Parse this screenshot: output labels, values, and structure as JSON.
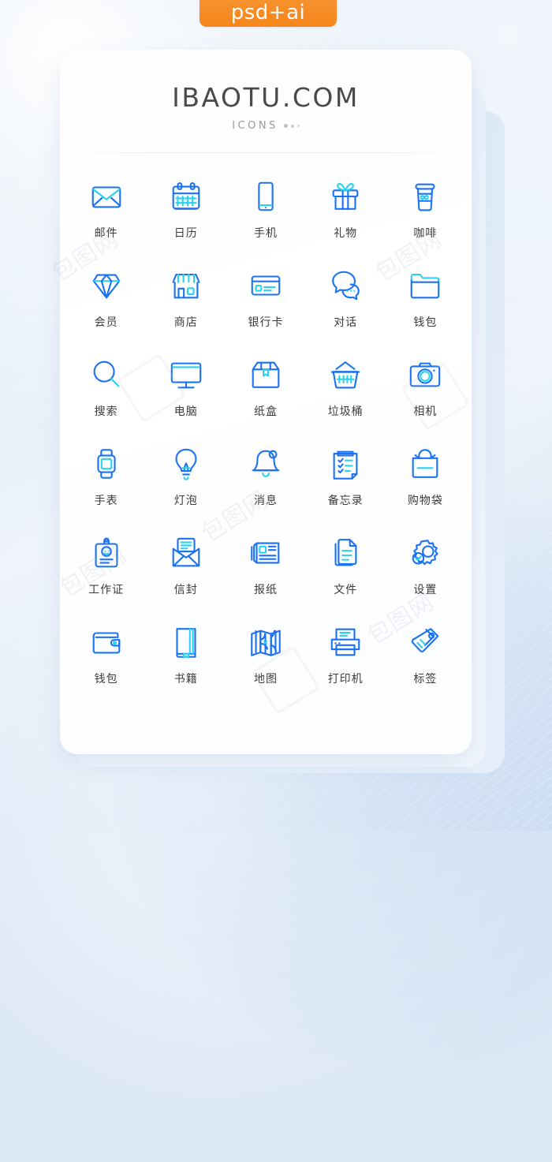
{
  "badge": {
    "label": "psd+ai",
    "color": "#F5861B"
  },
  "header": {
    "title": "IBAOTU.COM",
    "subtitle": "ICONS"
  },
  "theme": {
    "icon_blue": "#1B72F2",
    "icon_cyan": "#29D2F0",
    "label_color": "#3B3B3B",
    "background": "#DCE8F6",
    "card_background": "#FFFFFF"
  },
  "watermarks": [
    "包图网",
    "包图网",
    "包图网",
    "包图网",
    "包图网"
  ],
  "icons": [
    {
      "label": "邮件",
      "name": "mail-icon"
    },
    {
      "label": "日历",
      "name": "calendar-icon"
    },
    {
      "label": "手机",
      "name": "phone-icon"
    },
    {
      "label": "礼物",
      "name": "gift-icon"
    },
    {
      "label": "咖啡",
      "name": "coffee-icon"
    },
    {
      "label": "会员",
      "name": "diamond-member-icon"
    },
    {
      "label": "商店",
      "name": "store-icon"
    },
    {
      "label": "银行卡",
      "name": "bank-card-icon"
    },
    {
      "label": "对话",
      "name": "chat-bubbles-icon"
    },
    {
      "label": "钱包",
      "name": "folder-icon"
    },
    {
      "label": "搜索",
      "name": "search-icon"
    },
    {
      "label": "电脑",
      "name": "computer-monitor-icon"
    },
    {
      "label": "纸盒",
      "name": "paper-box-icon"
    },
    {
      "label": "垃圾桶",
      "name": "trash-basket-icon"
    },
    {
      "label": "相机",
      "name": "camera-icon"
    },
    {
      "label": "手表",
      "name": "watch-icon"
    },
    {
      "label": "灯泡",
      "name": "light-bulb-icon"
    },
    {
      "label": "消息",
      "name": "bell-message-icon"
    },
    {
      "label": "备忘录",
      "name": "memo-clipboard-icon"
    },
    {
      "label": "购物袋",
      "name": "shopping-bag-icon"
    },
    {
      "label": "工作证",
      "name": "work-badge-icon"
    },
    {
      "label": "信封",
      "name": "open-envelope-icon"
    },
    {
      "label": "报纸",
      "name": "newspaper-icon"
    },
    {
      "label": "文件",
      "name": "document-file-icon"
    },
    {
      "label": "设置",
      "name": "settings-gear-icon"
    },
    {
      "label": "钱包",
      "name": "wallet-icon"
    },
    {
      "label": "书籍",
      "name": "book-icon"
    },
    {
      "label": "地图",
      "name": "map-icon"
    },
    {
      "label": "打印机",
      "name": "printer-icon"
    },
    {
      "label": "标签",
      "name": "tag-icon"
    }
  ]
}
